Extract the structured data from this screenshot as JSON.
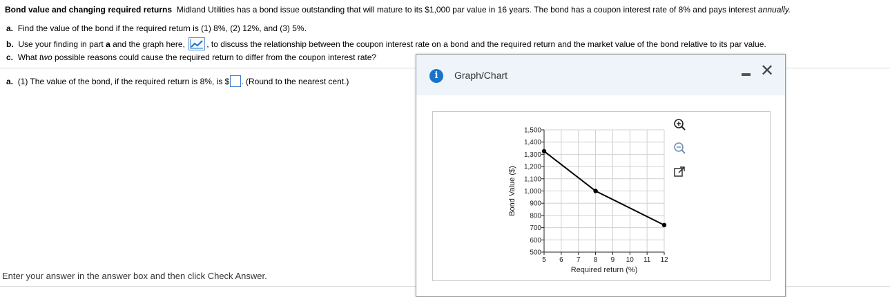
{
  "problem": {
    "title": "Bond value and changing required returns",
    "text": "Midland Utilities has a bond issue outstanding that will mature to its $1,000 par value in 16 years.  The bond has a coupon interest rate of 8% and pays interest ",
    "emph": "annually.",
    "part_a_label": "a.",
    "part_a_text": "Find the value of the bond if the required return is (1) 8%, (2) 12%, and (3) 5%.",
    "part_b_label": "b.",
    "part_b_pre": "Use your finding in part ",
    "part_b_bold": "a",
    "part_b_mid": " and the graph here, ",
    "part_b_post": ", to discuss the relationship between the coupon interest rate on a bond and the required return and the market value of the bond relative to its par value.",
    "part_c_label": "c.",
    "part_c_pre": "What ",
    "part_c_em": "two",
    "part_c_post": " possible reasons could cause the required return to differ from the coupon interest rate?"
  },
  "answer": {
    "label": "a.",
    "prompt": "(1) The value of the bond, if the required return is 8%, is $",
    "value": "",
    "hint": ". (Round to the nearest cent.)"
  },
  "instructions": "Enter your answer in the answer box and then click Check Answer.",
  "popup": {
    "title": "Graph/Chart",
    "info_icon": "i",
    "close_glyph": "✕"
  },
  "colors": {
    "accent": "#1a73c9",
    "header_bg": "#eef4fa"
  },
  "chart_data": {
    "type": "line",
    "xlabel": "Required return (%)",
    "ylabel": "Bond Value ($)",
    "xlim": [
      5,
      12
    ],
    "ylim": [
      500,
      1500
    ],
    "x_ticks": [
      "5",
      "6",
      "7",
      "8",
      "9",
      "10",
      "11",
      "12"
    ],
    "y_ticks": [
      "500",
      "600",
      "700",
      "800",
      "900",
      "1,000",
      "1,100",
      "1,200",
      "1,300",
      "1,400",
      "1,500"
    ],
    "grid": true,
    "series": [
      {
        "x": [
          5,
          8,
          12
        ],
        "y": [
          1325,
          1000,
          721
        ]
      }
    ]
  }
}
